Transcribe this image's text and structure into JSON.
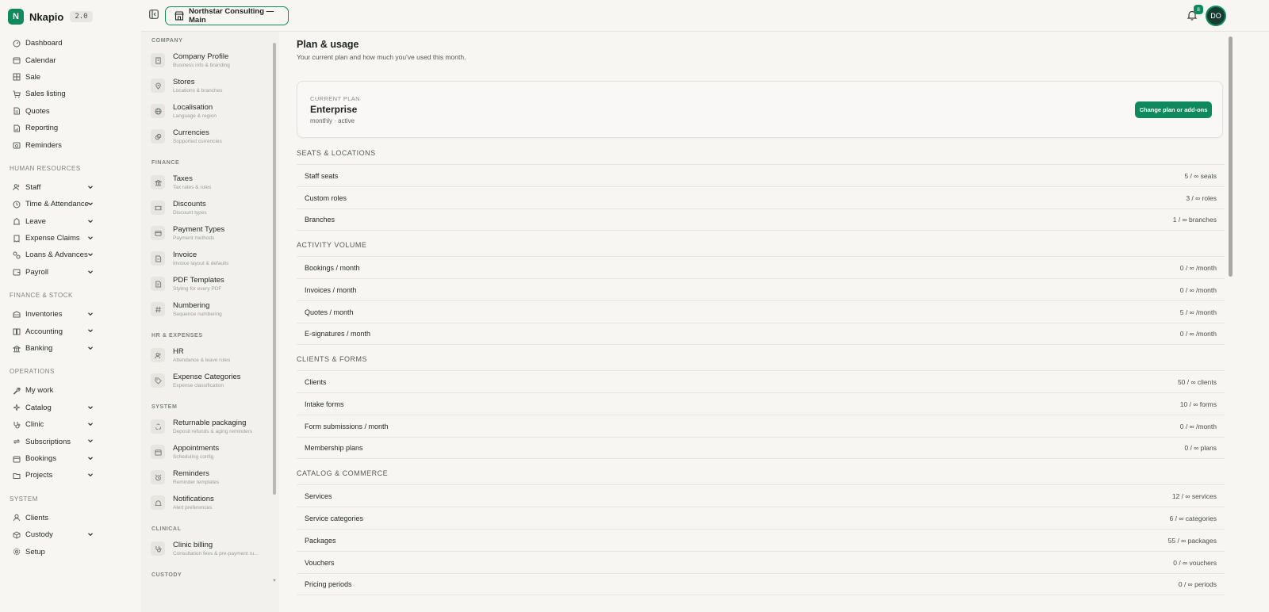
{
  "brand": {
    "name": "Nkapio",
    "version": "2.0",
    "logo_letter": "N",
    "accent": "#0f8a5f"
  },
  "topbar": {
    "workspace": "Northstar Consulting — Main",
    "notifications": "8",
    "avatar_initials": "DO"
  },
  "sidebar": {
    "top_items": [
      {
        "label": "Dashboard",
        "icon": "dashboard-icon"
      },
      {
        "label": "Calendar",
        "icon": "calendar-icon"
      },
      {
        "label": "Sale",
        "icon": "grid-icon"
      },
      {
        "label": "Sales listing",
        "icon": "cart-icon"
      },
      {
        "label": "Quotes",
        "icon": "document-icon"
      },
      {
        "label": "Reporting",
        "icon": "report-icon"
      },
      {
        "label": "Reminders",
        "icon": "reminder-icon"
      }
    ],
    "sections": [
      {
        "title": "HUMAN RESOURCES",
        "items": [
          {
            "label": "Staff",
            "expandable": true
          },
          {
            "label": "Time & Attendance",
            "expandable": true
          },
          {
            "label": "Leave",
            "expandable": true
          },
          {
            "label": "Expense Claims",
            "expandable": true
          },
          {
            "label": "Loans & Advances",
            "expandable": true
          },
          {
            "label": "Payroll",
            "expandable": true
          }
        ]
      },
      {
        "title": "FINANCE & STOCK",
        "items": [
          {
            "label": "Inventories",
            "expandable": true
          },
          {
            "label": "Accounting",
            "expandable": true
          },
          {
            "label": "Banking",
            "expandable": true
          }
        ]
      },
      {
        "title": "OPERATIONS",
        "items": [
          {
            "label": "My work",
            "expandable": false
          },
          {
            "label": "Catalog",
            "expandable": true
          },
          {
            "label": "Clinic",
            "expandable": true
          },
          {
            "label": "Subscriptions",
            "expandable": true
          },
          {
            "label": "Bookings",
            "expandable": true
          },
          {
            "label": "Projects",
            "expandable": true
          }
        ]
      },
      {
        "title": "SYSTEM",
        "items": [
          {
            "label": "Clients",
            "expandable": false
          },
          {
            "label": "Custody",
            "expandable": true
          },
          {
            "label": "Setup",
            "expandable": false
          }
        ]
      }
    ]
  },
  "settings_nav": [
    {
      "title": "COMPANY",
      "items": [
        {
          "label": "Company Profile",
          "sub": "Business info & branding",
          "icon": "building-icon"
        },
        {
          "label": "Stores",
          "sub": "Locations & branches",
          "icon": "location-pin-icon"
        },
        {
          "label": "Localisation",
          "sub": "Language & region",
          "icon": "globe-icon"
        },
        {
          "label": "Currencies",
          "sub": "Supported currencies",
          "icon": "coins-icon"
        }
      ]
    },
    {
      "title": "FINANCE",
      "items": [
        {
          "label": "Taxes",
          "sub": "Tax rates & rules",
          "icon": "bank-icon"
        },
        {
          "label": "Discounts",
          "sub": "Discount types",
          "icon": "ticket-icon"
        },
        {
          "label": "Payment Types",
          "sub": "Payment methods",
          "icon": "credit-card-icon"
        },
        {
          "label": "Invoice",
          "sub": "Invoice layout & defaults",
          "icon": "file-icon"
        },
        {
          "label": "PDF Templates",
          "sub": "Styling for every PDF",
          "icon": "pdf-icon"
        },
        {
          "label": "Numbering",
          "sub": "Sequence numbering",
          "icon": "hash-icon"
        }
      ]
    },
    {
      "title": "HR & EXPENSES",
      "items": [
        {
          "label": "HR",
          "sub": "Attendance & leave rules",
          "icon": "users-icon"
        },
        {
          "label": "Expense Categories",
          "sub": "Expense classification",
          "icon": "tag-icon"
        }
      ]
    },
    {
      "title": "SYSTEM",
      "items": [
        {
          "label": "Returnable packaging",
          "sub": "Deposit refunds & aging reminders",
          "icon": "recycle-icon"
        },
        {
          "label": "Appointments",
          "sub": "Scheduling config",
          "icon": "calendar-icon"
        },
        {
          "label": "Reminders",
          "sub": "Reminder templates",
          "icon": "alarm-icon"
        },
        {
          "label": "Notifications",
          "sub": "Alert preferences",
          "icon": "bell-icon"
        }
      ]
    },
    {
      "title": "CLINICAL",
      "items": [
        {
          "label": "Clinic billing",
          "sub": "Consultation fees & pre-payment ru...",
          "icon": "stethoscope-icon"
        }
      ]
    },
    {
      "title": "CUSTODY",
      "items": []
    }
  ],
  "main": {
    "title": "Plan & usage",
    "subtitle": "Your current plan and how much you've used this month.",
    "plan": {
      "kicker": "CURRENT PLAN",
      "name": "Enterprise",
      "status": "monthly · active",
      "button": "Change plan or add-ons"
    },
    "groups": [
      {
        "title": "SEATS & LOCATIONS",
        "rows": [
          {
            "label": "Staff seats",
            "value": "5 / ∞ seats"
          },
          {
            "label": "Custom roles",
            "value": "3 / ∞ roles"
          },
          {
            "label": "Branches",
            "value": "1 / ∞ branches"
          }
        ]
      },
      {
        "title": "ACTIVITY VOLUME",
        "rows": [
          {
            "label": "Bookings / month",
            "value": "0 / ∞ /month"
          },
          {
            "label": "Invoices / month",
            "value": "0 / ∞ /month"
          },
          {
            "label": "Quotes / month",
            "value": "5 / ∞ /month"
          },
          {
            "label": "E-signatures / month",
            "value": "0 / ∞ /month"
          }
        ]
      },
      {
        "title": "CLIENTS & FORMS",
        "rows": [
          {
            "label": "Clients",
            "value": "50 / ∞ clients"
          },
          {
            "label": "Intake forms",
            "value": "10 / ∞ forms"
          },
          {
            "label": "Form submissions / month",
            "value": "0 / ∞ /month"
          },
          {
            "label": "Membership plans",
            "value": "0 / ∞ plans"
          }
        ]
      },
      {
        "title": "CATALOG & COMMERCE",
        "rows": [
          {
            "label": "Services",
            "value": "12 / ∞ services"
          },
          {
            "label": "Service categories",
            "value": "6 / ∞ categories"
          },
          {
            "label": "Packages",
            "value": "55 / ∞ packages"
          },
          {
            "label": "Vouchers",
            "value": "0 / ∞ vouchers"
          },
          {
            "label": "Pricing periods",
            "value": "0 / ∞ periods"
          }
        ]
      }
    ]
  }
}
